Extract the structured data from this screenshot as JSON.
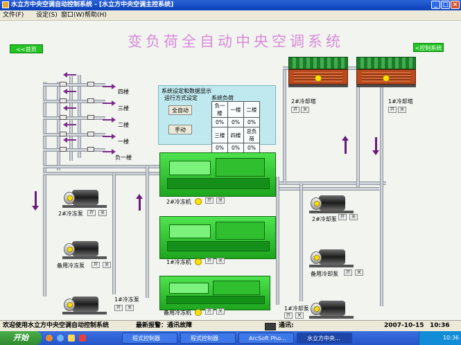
{
  "window": {
    "title": "水立方中央空调自动控制系统 - [水立方中央空调主控系统]"
  },
  "menu": [
    {
      "label": "文件(F)"
    },
    {
      "label": "设定(S)"
    },
    {
      "label": "窗口(W)"
    },
    {
      "label": "帮助(H)"
    }
  ],
  "main_title": "变负荷全自动中央空调系统",
  "nav": {
    "home": "<<首页",
    "control": "<控制系统"
  },
  "floors": [
    "四楼",
    "三楼",
    "二楼",
    "一楼",
    "负一楼"
  ],
  "panel": {
    "title": "系统设定和数据显示",
    "mode_label": "运行方式设定",
    "auto_btn": "全自动",
    "manual_btn": "手动",
    "load_label": "系统负荷",
    "load_table": [
      [
        "负一楼",
        "一楼",
        "二楼"
      ],
      [
        "0%",
        "0%",
        "0%"
      ],
      [
        "三楼",
        "四楼",
        "总负荷"
      ],
      [
        "0%",
        "0%",
        "0%"
      ]
    ]
  },
  "towers": [
    {
      "label": "2#冷却塔"
    },
    {
      "label": "1#冷却塔"
    }
  ],
  "chillers": [
    {
      "label": "2#冷冻机"
    },
    {
      "label": "1#冷冻机"
    },
    {
      "label": "备用冷冻机"
    }
  ],
  "chilled_pumps": [
    {
      "label": "2#冷冻泵"
    },
    {
      "label": "备用冷冻泵"
    },
    {
      "label": "1#冷冻泵"
    }
  ],
  "cooling_pumps": [
    {
      "label": "2#冷却泵"
    },
    {
      "label": "备用冷却泵"
    },
    {
      "label": "1#冷却泵"
    }
  ],
  "control": {
    "on": "开",
    "off": "关"
  },
  "status": {
    "welcome": "欢迎使用水立方中央空调自动控制系统",
    "alarm": "最新报警：通讯故障",
    "comm": "通讯:",
    "date": "2007-10-15",
    "time": "10:36"
  },
  "taskbar": {
    "start": "开始",
    "tasks": [
      "程式控制器",
      "程式控制器",
      "ArcSoft Pho...",
      "水立方中央..."
    ],
    "clock": "10:36"
  },
  "colors": {
    "title_pink": "#d88ad8",
    "chiller_green": "#2fbf2f",
    "panel_cyan": "#bfe9ef",
    "status_yellow": "#ffe100"
  }
}
